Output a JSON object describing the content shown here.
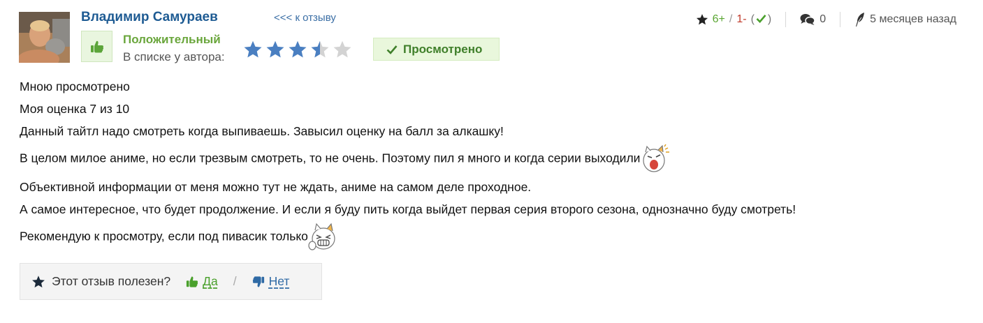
{
  "header": {
    "author_name": "Владимир Самураев",
    "back_link": "<<< к отзыву",
    "verdict": "Положительный",
    "list_label": "В списке у автора:",
    "rating_stars": 3.5,
    "rating_max": 5,
    "status_badge": "Просмотрено"
  },
  "meta": {
    "plus_votes": "6+",
    "separator": "/",
    "minus_votes": "1-",
    "comments_count": "0",
    "time_ago": "5 месяцев назад"
  },
  "review": {
    "lines": [
      "Мною просмотрено",
      "Моя оценка 7 из 10",
      "Данный тайтл надо смотреть когда выпиваешь. Завысил оценку на балл за алкашку!",
      "В целом милое аниме, но если трезвым смотреть, то не очень. Поэтому пил я много и когда серии выходили",
      "Объективной информации от меня можно тут не ждать, аниме на самом деле проходное.",
      "А самое интересное, что будет продолжение. И если я буду пить когда выйдет первая серия второго сезона, однозначно буду смотреть!",
      "Рекомендую к просмотру, если под пивасик только"
    ]
  },
  "helpful": {
    "question": "Этот отзыв полезен?",
    "yes_label": "Да",
    "divider": "/",
    "no_label": "Нет"
  },
  "colors": {
    "author": "#1e5b93",
    "verdict": "#6aa63c",
    "star_filled": "#4a7fc1",
    "star_empty": "#d3d3d3",
    "badge_bg": "#e9f7dc",
    "yes": "#4aa02c",
    "no": "#2f6aa5"
  },
  "icons": {
    "avatar": "user-avatar-photo",
    "verdict": "thumbs-up-icon",
    "badge": "check-icon",
    "meta_star": "star-icon",
    "meta_check": "check-icon",
    "comments": "comments-icon",
    "time": "feather-icon",
    "helpful_star": "star-icon",
    "yes": "thumbs-up-icon",
    "no": "thumbs-down-icon",
    "emoji_1": "crying-cat-emoji",
    "emoji_2": "laughing-cat-emoji"
  }
}
